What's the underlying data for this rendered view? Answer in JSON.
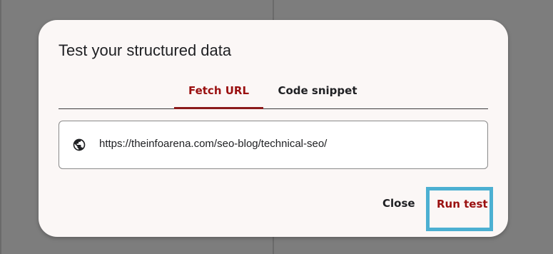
{
  "dialog": {
    "title": "Test your structured data",
    "tabs": [
      {
        "label": "Fetch URL",
        "active": true
      },
      {
        "label": "Code snippet",
        "active": false
      }
    ],
    "url_field": {
      "value": "https://theinfoarena.com/seo-blog/technical-seo/",
      "icon": "globe-icon"
    },
    "actions": {
      "close_label": "Close",
      "run_label": "Run test"
    }
  },
  "colors": {
    "accent": "#9a1010",
    "highlight_outline": "#4cb0d2",
    "dialog_bg": "#fbf7f6",
    "backdrop": "#7d7d7d"
  }
}
